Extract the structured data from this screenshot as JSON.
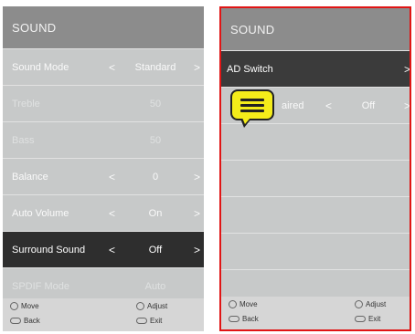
{
  "left": {
    "title": "SOUND",
    "rows": [
      {
        "label": "Sound Mode",
        "value": "Standard",
        "left_arrow": "<",
        "right_arrow": ">"
      },
      {
        "label": "Treble",
        "value": "50"
      },
      {
        "label": "Bass",
        "value": "50"
      },
      {
        "label": "Balance",
        "value": "0",
        "left_arrow": "<",
        "right_arrow": ">"
      },
      {
        "label": "Auto Volume",
        "value": "On",
        "left_arrow": "<",
        "right_arrow": ">"
      },
      {
        "label": "Surround Sound",
        "value": "Off",
        "left_arrow": "<",
        "right_arrow": ">"
      },
      {
        "label": "SPDIF Mode",
        "value": "Auto"
      }
    ],
    "footer": {
      "move": "Move",
      "adjust": "Adjust",
      "back": "Back",
      "exit": "Exit"
    }
  },
  "right": {
    "title": "SOUND",
    "rows": [
      {
        "label": "AD Switch",
        "right_arrow": ">"
      },
      {
        "label": "aired",
        "value": "Off",
        "left_arrow": "<",
        "right_arrow": ">"
      }
    ],
    "footer": {
      "move": "Move",
      "adjust": "Adjust",
      "back": "Back",
      "exit": "Exit"
    }
  },
  "colors": {
    "panel": "#c7c9c9",
    "header": "#8c8c8c",
    "selected": "#2e2e2e",
    "highlight_border": "#e01515",
    "bubble": "#f4ec1a"
  },
  "icons": [
    "move-icon",
    "adjust-icon",
    "back-icon",
    "exit-icon",
    "speech-bubble-icon"
  ]
}
